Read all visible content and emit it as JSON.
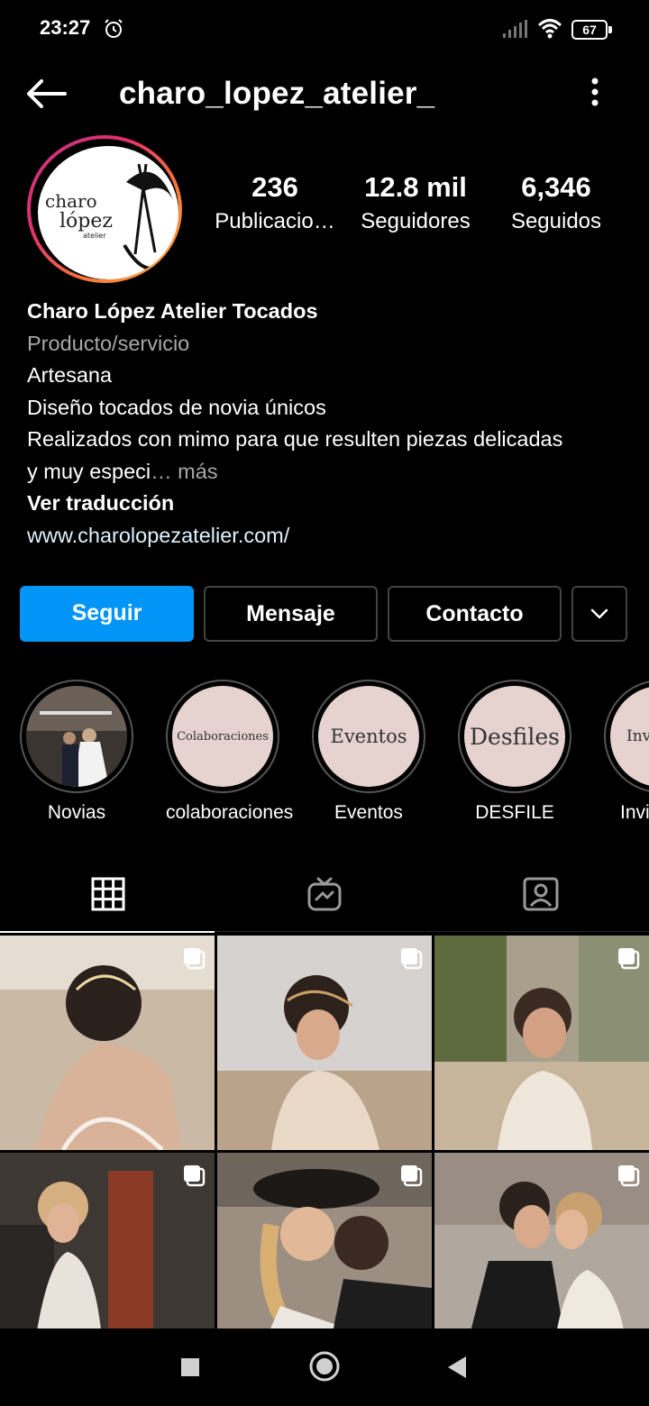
{
  "status_bar": {
    "time": "23:27",
    "battery": "67"
  },
  "header": {
    "username": "charo_lopez_atelier_"
  },
  "avatar": {
    "logo_text": "charo lópez atelier"
  },
  "stats": [
    {
      "value": "236",
      "label": "Publicacio…"
    },
    {
      "value": "12.8 mil",
      "label": "Seguidores"
    },
    {
      "value": "6,346",
      "label": "Seguidos"
    }
  ],
  "bio": {
    "name": "Charo López Atelier Tocados",
    "category": "Producto/servicio",
    "line1": "Artesana",
    "line2": "Diseño tocados de novia únicos",
    "line3": "Realizados con mimo para que resulten piezas  delicadas",
    "line4": "y muy especi",
    "more": "… más",
    "translate": "Ver traducción",
    "website": "www.charolopezatelier.com/"
  },
  "buttons": {
    "follow": "Seguir",
    "message": "Mensaje",
    "contact": "Contacto"
  },
  "highlights": [
    {
      "label": "Novias",
      "cover_text": ""
    },
    {
      "label": "colaboraciones",
      "cover_text": "Colaboraciones"
    },
    {
      "label": "Eventos",
      "cover_text": "Eventos"
    },
    {
      "label": "DESFILE",
      "cover_text": "Desfiles"
    },
    {
      "label": "Invi",
      "cover_text": "Inv"
    }
  ],
  "colors": {
    "accent": "#0095f6",
    "background": "#000000",
    "secondary_text": "#a8a8a8",
    "highlight_cover": "#e6d2ce"
  }
}
